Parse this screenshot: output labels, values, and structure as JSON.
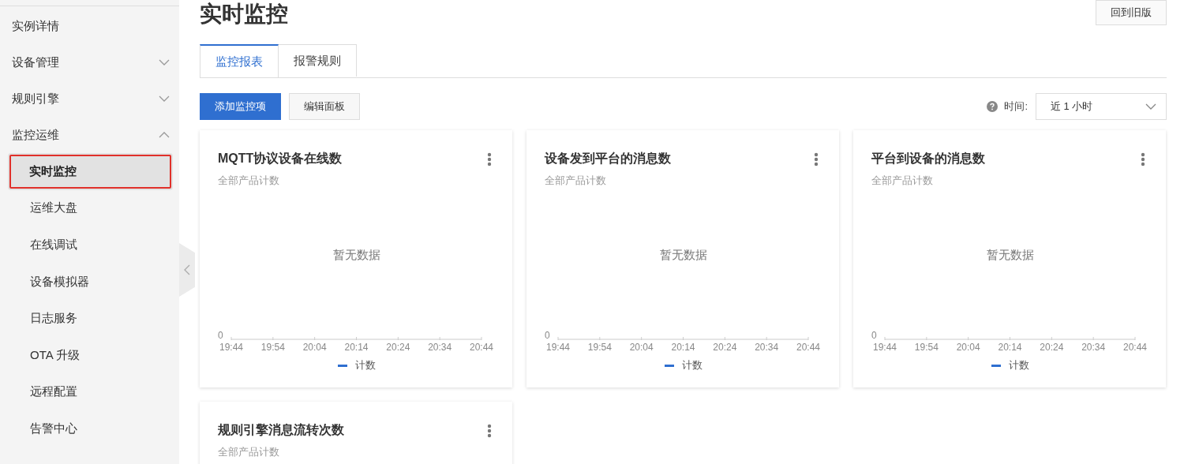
{
  "sidebar": {
    "items": [
      {
        "label": "实例详情",
        "selected": false
      },
      {
        "label": "设备管理",
        "expanded": false,
        "selected": false
      },
      {
        "label": "规则引擎",
        "expanded": false,
        "selected": false
      },
      {
        "label": "监控运维",
        "expanded": true,
        "selected": false,
        "children": [
          {
            "label": "实时监控",
            "selected": true
          },
          {
            "label": "运维大盘",
            "selected": false
          },
          {
            "label": "在线调试",
            "selected": false
          },
          {
            "label": "设备模拟器",
            "selected": false
          },
          {
            "label": "日志服务",
            "selected": false
          },
          {
            "label": "OTA 升级",
            "selected": false
          },
          {
            "label": "远程配置",
            "selected": false
          },
          {
            "label": "告警中心",
            "selected": false
          }
        ]
      }
    ]
  },
  "page": {
    "title": "实时监控",
    "old_version_button": "回到旧版"
  },
  "tabs": [
    {
      "label": "监控报表",
      "selected": true
    },
    {
      "label": "报警规则",
      "selected": false
    }
  ],
  "toolbar": {
    "buttons": [
      {
        "label": "添加监控项",
        "kind": "primary"
      },
      {
        "label": "编辑面板",
        "kind": "normal"
      }
    ],
    "time_label": "时间:",
    "time_select": "近 1 小时"
  },
  "cards": [
    {
      "title": "MQTT协议设备在线数",
      "subtitle": "全部产品计数",
      "empty_text": "暂无数据",
      "axis": {
        "y_label": "0",
        "x_labels": [
          "19:44",
          "19:54",
          "20:04",
          "20:14",
          "20:24",
          "20:34",
          "20:44"
        ]
      },
      "legend": [
        {
          "name": "计数",
          "color": "#2f6fd0"
        }
      ]
    },
    {
      "title": "设备发到平台的消息数",
      "subtitle": "全部产品计数",
      "empty_text": "暂无数据",
      "axis": {
        "y_label": "0",
        "x_labels": [
          "19:44",
          "19:54",
          "20:04",
          "20:14",
          "20:24",
          "20:34",
          "20:44"
        ]
      },
      "legend": [
        {
          "name": "计数",
          "color": "#2f6fd0"
        }
      ]
    },
    {
      "title": "平台到设备的消息数",
      "subtitle": "全部产品计数",
      "empty_text": "暂无数据",
      "axis": {
        "y_label": "0",
        "x_labels": [
          "19:44",
          "19:54",
          "20:04",
          "20:14",
          "20:24",
          "20:34",
          "20:44"
        ]
      },
      "legend": [
        {
          "name": "计数",
          "color": "#2f6fd0"
        }
      ]
    },
    {
      "title": "规则引擎消息流转次数",
      "subtitle": "全部产品计数"
    }
  ]
}
